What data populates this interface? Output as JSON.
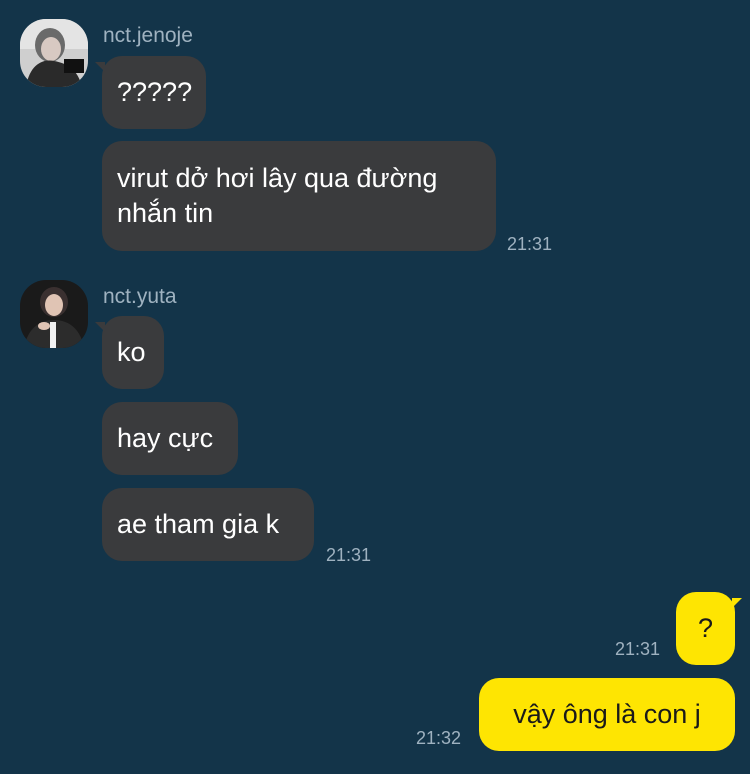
{
  "chat": {
    "jenoje": {
      "name": "nct.jenoje",
      "messages": [
        "?????",
        "virut dở hơi lây qua đường nhắn tin"
      ],
      "time": "21:31"
    },
    "yuta": {
      "name": "nct.yuta",
      "messages": [
        "ko",
        "hay cực",
        "ae tham gia k"
      ],
      "time": "21:31"
    },
    "me": [
      {
        "text": "?",
        "time": "21:31"
      },
      {
        "text": "vậy ông là con j",
        "time": "21:32"
      }
    ]
  },
  "colors": {
    "background": "#133449",
    "incoming_bubble": "#3a3b3d",
    "outgoing_bubble": "#fee502",
    "meta_text": "#9fb2c0"
  }
}
